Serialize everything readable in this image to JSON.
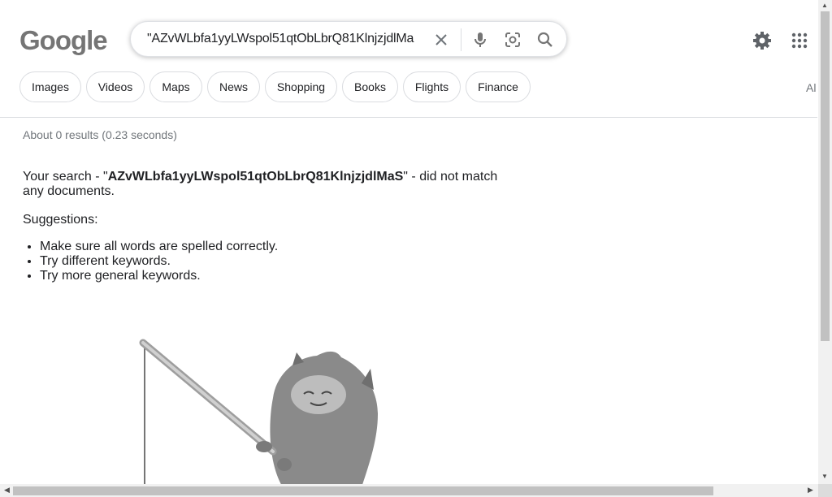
{
  "header": {
    "logo_text": "Google",
    "search_query": "\"AZvWLbfa1yyLWspol51qtObLbrQ81KlnjzjdlMa",
    "icons": {
      "clear": "close-icon",
      "mic": "microphone-icon",
      "lens": "camera-lens-icon",
      "search": "search-icon",
      "settings": "gear-icon",
      "apps": "apps-grid-icon"
    }
  },
  "tabs": [
    {
      "label": "Images"
    },
    {
      "label": "Videos"
    },
    {
      "label": "Maps"
    },
    {
      "label": "News"
    },
    {
      "label": "Shopping"
    },
    {
      "label": "Books"
    },
    {
      "label": "Flights"
    },
    {
      "label": "Finance"
    }
  ],
  "tabs_overflow_label": "Al",
  "results": {
    "stats": "About 0 results (0.23 seconds)",
    "message_prefix": "Your search - \"",
    "message_query": "AZvWLbfa1yyLWspol51qtObLbrQ81KlnjzjdlMaS",
    "message_suffix": "\" - did not match any documents.",
    "suggestions_title": "Suggestions:",
    "suggestions": [
      "Make sure all words are spelled correctly.",
      "Try different keywords.",
      "Try more general keywords."
    ]
  }
}
